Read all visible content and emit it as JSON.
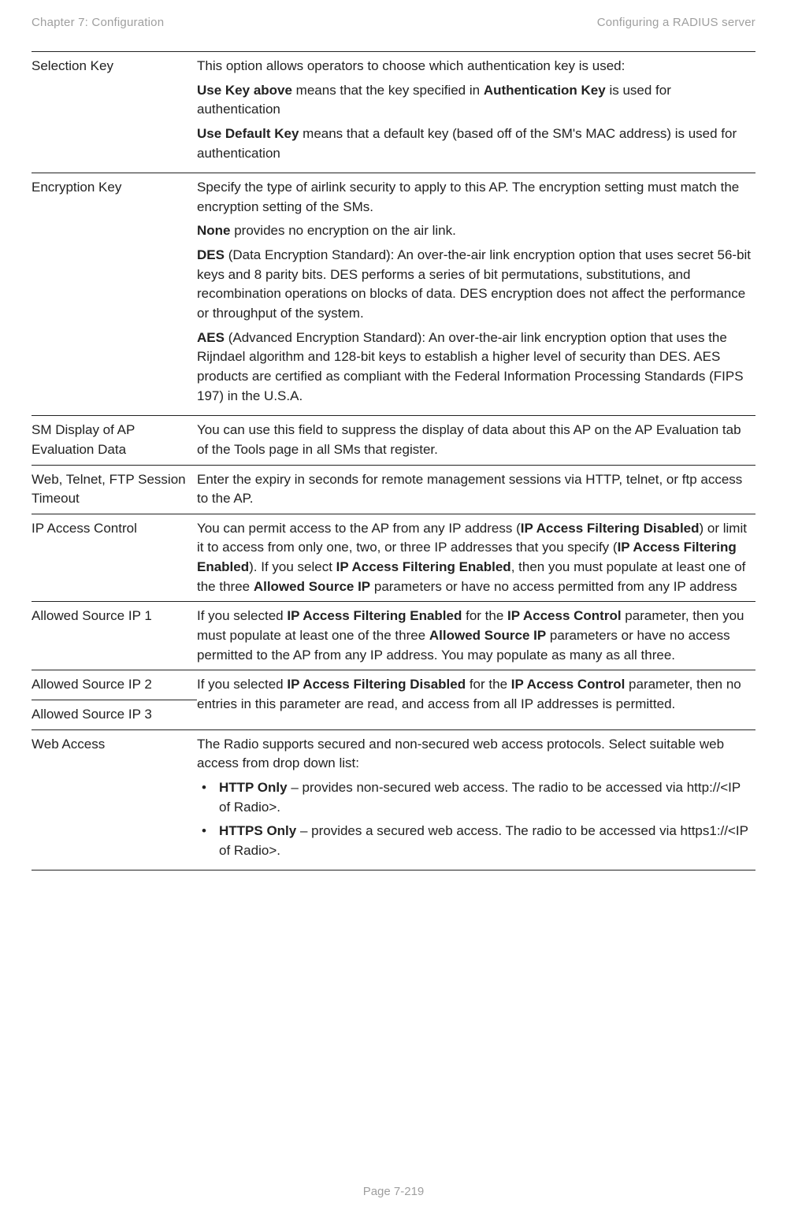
{
  "header": {
    "left": "Chapter 7:  Configuration",
    "right": "Configuring a RADIUS server"
  },
  "rows": {
    "selectionKey": {
      "label": "Selection Key",
      "p1": "This option allows operators to choose which authentication key is used:",
      "p2a": "Use Key above",
      "p2b": " means that the key specified in ",
      "p2c": "Authentication Key",
      "p2d": " is used for authentication",
      "p3a": "Use Default Key",
      "p3b": " means that a default key (based off of the SM's MAC address) is used for authentication"
    },
    "encryptionKey": {
      "label": "Encryption Key",
      "p1": "Specify the type of airlink security to apply to this AP. The encryption setting must match the encryption setting of the SMs.",
      "p2a": "None",
      "p2b": " provides no encryption on the air link.",
      "p3a": "DES",
      "p3b": " (Data Encryption Standard): An over-the-air link encryption option that uses secret 56-bit keys and 8 parity bits. DES performs a series of bit permutations, substitutions, and recombination operations on blocks of data. DES encryption does not affect the performance or throughput of the system.",
      "p4a": "AES",
      "p4b": " (Advanced Encryption Standard): An over-the-air link encryption option that uses the Rijndael algorithm and 128-bit keys to establish a higher level of security than DES. AES products are certified as compliant with the Federal Information Processing Standards (FIPS 197) in the U.S.A."
    },
    "smDisplay": {
      "label": "SM Display of AP Evaluation Data",
      "text": "You can use this field to suppress the display of data about this AP on the AP Evaluation tab of the Tools page in all SMs that register."
    },
    "sessionTimeout": {
      "label": "Web, Telnet, FTP Session Timeout",
      "text": "Enter the expiry in seconds for remote management sessions via HTTP, telnet, or ftp access to the AP."
    },
    "ipAccess": {
      "label": "IP Access Control",
      "t1": "You can permit access to the AP from any IP address (",
      "b1": "IP Access Filtering Disabled",
      "t2": ") or limit it to access from only one, two, or three IP addresses that you specify (",
      "b2": "IP Access Filtering Enabled",
      "t3": "). If you select ",
      "b3": "IP Access Filtering Enabled",
      "t4": ", then you must populate at least one of the three ",
      "b4": "Allowed Source IP",
      "t5": " parameters or have no access permitted from any IP address"
    },
    "allowed1": {
      "label": "Allowed Source IP 1",
      "t1": "If you selected ",
      "b1": "IP Access Filtering Enabled",
      "t2": " for the ",
      "b2": "IP Access Control",
      "t3": " parameter, then you must populate at least one of the three ",
      "b3": "Allowed Source IP",
      "t4": " parameters or have no access permitted to the AP from any IP address. You may populate as many as all three."
    },
    "allowed2": {
      "label": "Allowed Source IP 2",
      "t1": "If you selected ",
      "b1": "IP Access Filtering Disabled",
      "t2": " for the ",
      "b2": "IP Access Control",
      "t3": " parameter, then no entries in this parameter are read, and access from all IP addresses is permitted."
    },
    "allowed3": {
      "label": "Allowed Source IP 3"
    },
    "webAccess": {
      "label": "Web Access",
      "p1": "The Radio supports secured and non-secured web access protocols. Select suitable web access from drop down list:",
      "li1a": "HTTP Only",
      "li1b": " – provides non-secured web access. The radio to be accessed via http://<IP of Radio>.",
      "li2a": "HTTPS Only",
      "li2b": " – provides a secured web access. The radio to be accessed via https1://<IP of Radio>."
    }
  },
  "footer": "Page 7-219"
}
